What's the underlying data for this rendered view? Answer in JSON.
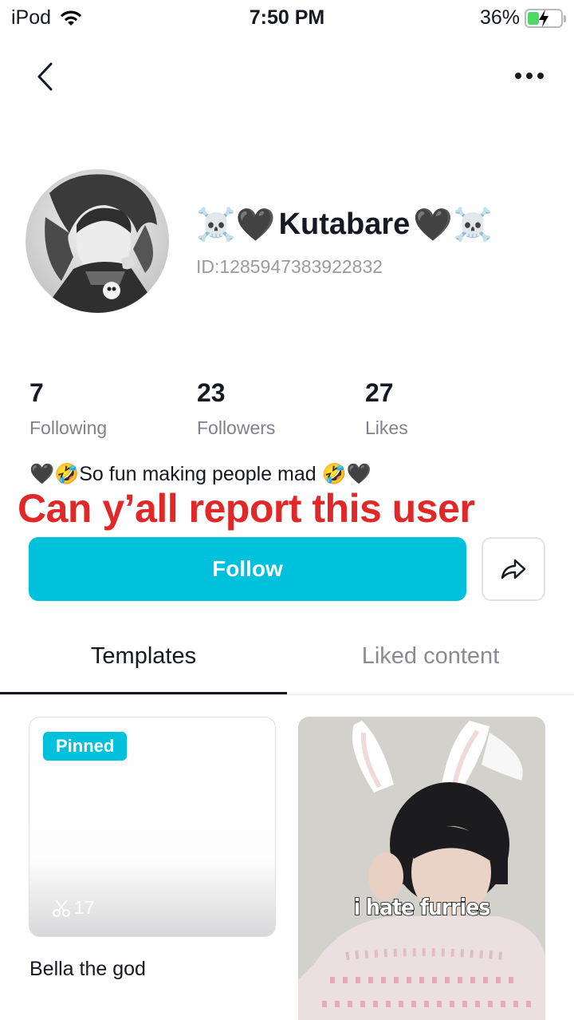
{
  "status_bar": {
    "carrier": "iPod",
    "time": "7:50 PM",
    "battery": "36%",
    "battery_level": 0.36
  },
  "profile": {
    "name_prefix": "☠️🖤",
    "name": "Kutabare",
    "name_suffix": "🖤☠️",
    "id": "ID:1285947383922832"
  },
  "stats": {
    "following_count": "7",
    "following_label": "Following",
    "followers_count": "23",
    "followers_label": "Followers",
    "likes_count": "27",
    "likes_label": "Likes"
  },
  "bio": {
    "line1": "🖤🤣So fun making people mad 🤣🖤"
  },
  "overlay_caption": "Can y’all report this user",
  "actions": {
    "follow": "Follow"
  },
  "tabs": {
    "templates": "Templates",
    "liked": "Liked content"
  },
  "templates": [
    {
      "badge": "Pinned",
      "uses": "17",
      "title": "Bella the god"
    },
    {
      "caption": "i hate furries"
    }
  ],
  "colors": {
    "accent": "#00c1db",
    "caption_red": "#e02828",
    "battery_green": "#4cd964"
  }
}
